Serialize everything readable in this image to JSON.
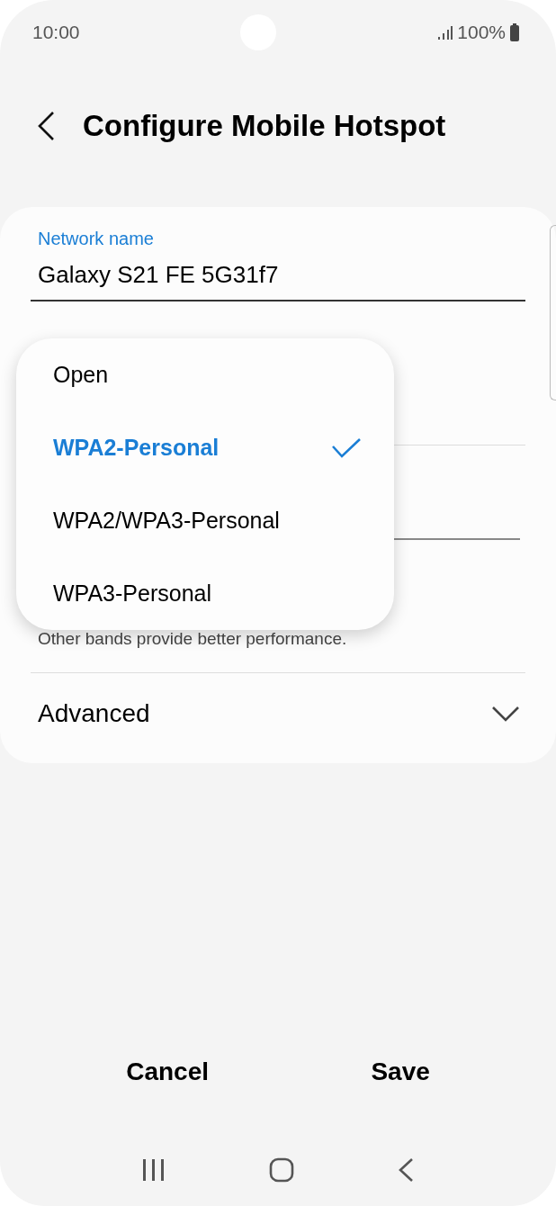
{
  "status_bar": {
    "time": "10:00",
    "battery": "100%"
  },
  "header": {
    "title": "Configure Mobile Hotspot"
  },
  "form": {
    "network_name": {
      "label": "Network name",
      "value": "Galaxy S21 FE 5G31f7"
    },
    "band_note": "Other bands provide better performance.",
    "advanced": {
      "label": "Advanced",
      "expanded": false
    }
  },
  "security_menu": [
    {
      "label": "Open",
      "selected": false
    },
    {
      "label": "WPA2-Personal",
      "selected": true
    },
    {
      "label": "WPA2/WPA3-Personal",
      "selected": false
    },
    {
      "label": "WPA3-Personal",
      "selected": false
    }
  ],
  "buttons": [
    "Cancel",
    "Save"
  ]
}
